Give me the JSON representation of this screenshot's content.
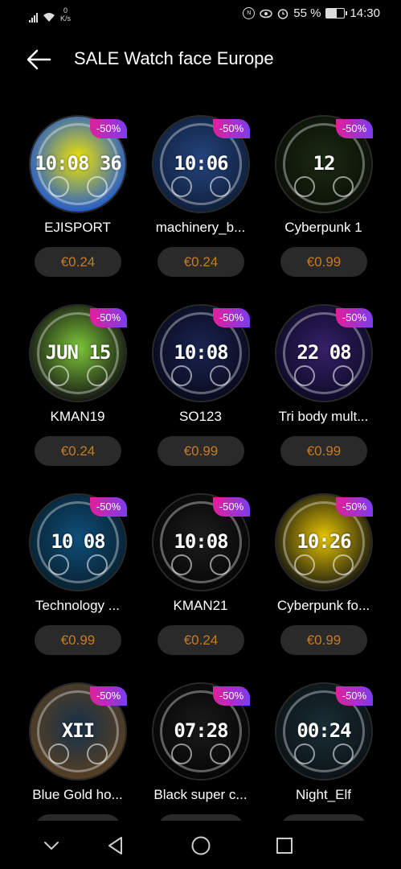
{
  "status_bar": {
    "network_speed": "0\nK/s",
    "battery_percent": "55 %",
    "battery_level": 0.55,
    "time": "14:30"
  },
  "header": {
    "title": "SALE Watch face Europe",
    "back_icon": "arrow-left-icon"
  },
  "items": [
    {
      "name": "EJISPORT",
      "price": "€0.24",
      "discount": "-50%",
      "colors": [
        "#f2e600",
        "#1a55d6"
      ],
      "face_text": "10:08 36"
    },
    {
      "name": "machinery_b...",
      "price": "€0.24",
      "discount": "-50%",
      "colors": [
        "#25457e",
        "#0e1e3a"
      ],
      "face_text": "10:06"
    },
    {
      "name": "Cyberpunk 1",
      "price": "€0.99",
      "discount": "-50%",
      "colors": [
        "#1b2a12",
        "#0a0f06"
      ],
      "face_text": "12"
    },
    {
      "name": "KMAN19",
      "price": "€0.24",
      "discount": "-50%",
      "colors": [
        "#7ec83a",
        "#111111"
      ],
      "face_text": "JUN 15"
    },
    {
      "name": "SO123",
      "price": "€0.99",
      "discount": "-50%",
      "colors": [
        "#1c2452",
        "#070a1c"
      ],
      "face_text": "10:08"
    },
    {
      "name": "Tri body mult...",
      "price": "€0.99",
      "discount": "-50%",
      "colors": [
        "#36206a",
        "#0c0a24"
      ],
      "face_text": "22 08"
    },
    {
      "name": "Technology ...",
      "price": "€0.99",
      "discount": "-50%",
      "colors": [
        "#0f4f7a",
        "#07202f"
      ],
      "face_text": "10 08"
    },
    {
      "name": "KMAN21",
      "price": "€0.24",
      "discount": "-50%",
      "colors": [
        "#1d1d1d",
        "#050505"
      ],
      "face_text": "10:08"
    },
    {
      "name": "Cyberpunk fo...",
      "price": "€0.99",
      "discount": "-50%",
      "colors": [
        "#e8c700",
        "#111111"
      ],
      "face_text": "10:26"
    },
    {
      "name": "Blue Gold ho...",
      "price": "",
      "discount": "-50%",
      "colors": [
        "#16304a",
        "#5a4020"
      ],
      "face_text": "XII"
    },
    {
      "name": "Black super c...",
      "price": "",
      "discount": "-50%",
      "colors": [
        "#1a1a1a",
        "#050505"
      ],
      "face_text": "07:28"
    },
    {
      "name": "Night_Elf",
      "price": "",
      "discount": "-50%",
      "colors": [
        "#1a2e36",
        "#0a1216"
      ],
      "face_text": "00:24"
    }
  ],
  "nav_bar": {
    "back_icon": "triangle-back-icon",
    "home_icon": "circle-home-icon",
    "recents_icon": "square-recents-icon",
    "hide_icon": "chevron-down-icon"
  }
}
